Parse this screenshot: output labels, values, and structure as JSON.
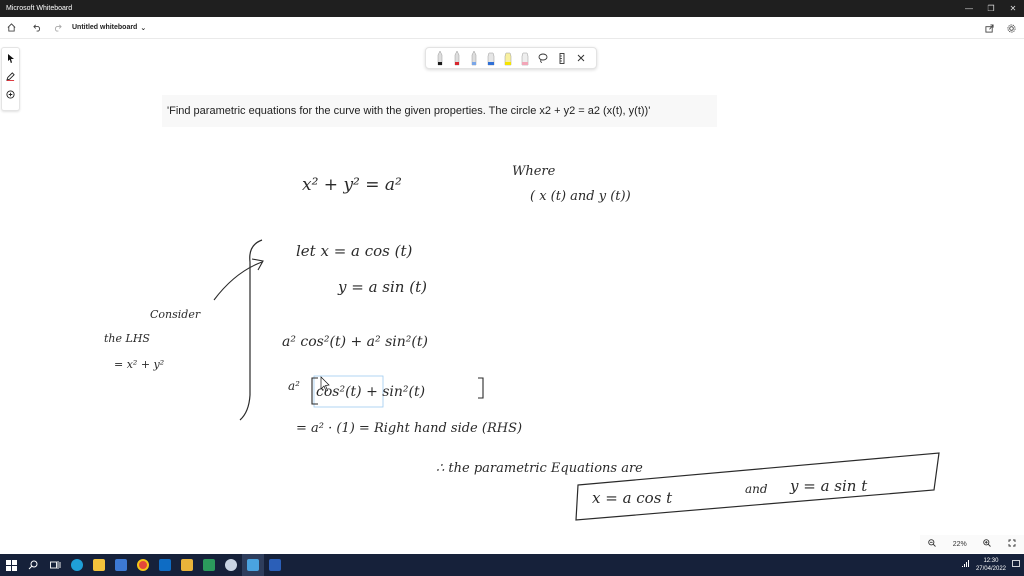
{
  "window": {
    "title": "Microsoft Whiteboard",
    "controls": [
      "—",
      "❐",
      "✕"
    ]
  },
  "appbar": {
    "doc_name": "Untitled whiteboard",
    "dropdown": "⌄"
  },
  "question": "'Find parametric equations for the curve with the given properties. The circle x2 + y2 = a2 (x(t), y(t))'",
  "ink": {
    "eq_main": "x² + y² = a²",
    "where_1": "Where",
    "where_2": "( x (t) and y (t))",
    "consider_1": "Consider",
    "consider_2": "the LHS",
    "consider_3": "= x² + y²",
    "let_x": "let  x  =  a cos (t)",
    "let_y": "y  =  a  sin (t)",
    "sum": "a² cos²(t)  +  a² sin²(t)",
    "factor_a": "a²",
    "factor": "cos²(t) + sin²(t)",
    "result": "=  a² · (1)   =  Right hand side (RHS)",
    "therefore": "∴  the  parametric  Equations  are",
    "answer_x": "x  =  a cos t",
    "answer_and": "and",
    "answer_y": "y  =  a sin t"
  },
  "zoom": {
    "level": "22%"
  },
  "taskbar": {
    "time": "12:30",
    "date": "27/04/2022"
  },
  "colors": {
    "titlebar": "#1f1f1f",
    "taskbar": "#16213a",
    "pen_black": "#1a1a1a",
    "pen_red": "#d8262e",
    "pen_blue": "#2f6fd6",
    "highlighter_yellow": "#f5e400",
    "highlighter_pink": "#f2a6b8",
    "selection": "#9ecbf0"
  }
}
